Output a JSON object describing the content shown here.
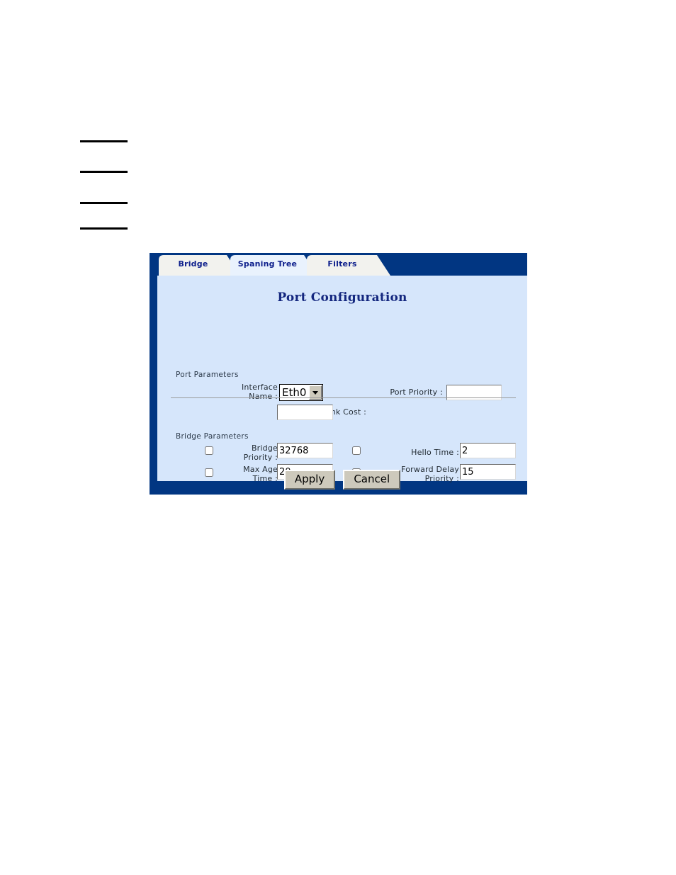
{
  "decor": {
    "rules_count": 4
  },
  "window": {
    "frame_color": "#013682",
    "content_color": "#d6e6fb"
  },
  "tabs": [
    {
      "id": "bridge",
      "label": "Bridge",
      "active": false
    },
    {
      "id": "spaning",
      "label": "Spaning Tree",
      "active": true
    },
    {
      "id": "filters",
      "label": "Filters",
      "active": false
    }
  ],
  "page": {
    "title": "Port Configuration",
    "title_color": "#14277f"
  },
  "sections": {
    "port_parameters": {
      "title": "Port Parameters",
      "fields": {
        "interface_name": {
          "label": "Interface\nName :",
          "value": "Eth0",
          "options": [
            "Eth0"
          ],
          "arrow_icon": "chevron-down-icon"
        },
        "port_priority": {
          "label": "Port Priority :",
          "value": "",
          "placeholder": ""
        },
        "link_cost": {
          "label": "Link Cost :",
          "value": "",
          "placeholder": ""
        }
      }
    },
    "bridge_parameters": {
      "title": "Bridge Parameters",
      "fields": {
        "bridge_priority": {
          "label": "Bridge\nPriority :",
          "value": "32768",
          "checked": false
        },
        "hello_time": {
          "label": "Hello Time :",
          "value": "2",
          "checked": false
        },
        "max_age_time": {
          "label": "Max Age\nTime :",
          "value": "20",
          "checked": false
        },
        "forward_delay_priority": {
          "label": "Forward Delay\nPriority :",
          "value": "15",
          "checked": false
        }
      }
    }
  },
  "buttons": {
    "apply": "Apply",
    "cancel": "Cancel"
  }
}
